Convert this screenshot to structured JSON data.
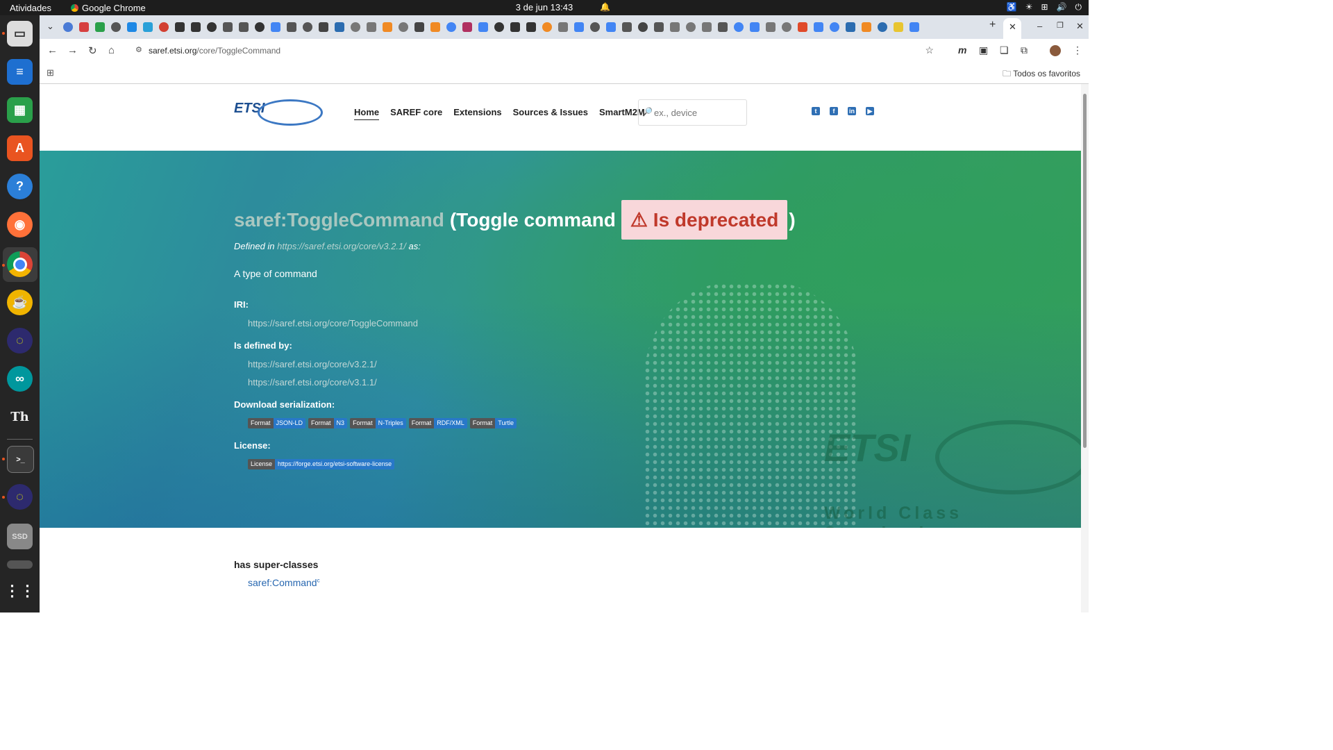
{
  "os": {
    "activities": "Atividades",
    "app_name": "Google Chrome",
    "clock": "3 de jun  13:43"
  },
  "browser": {
    "url_host": "saref.etsi.org",
    "url_path": "/core/ToggleCommand",
    "bookmarks_folder": "Todos os favoritos"
  },
  "site": {
    "nav": {
      "home": "Home",
      "saref_core": "SAREF core",
      "extensions": "Extensions",
      "sources_issues": "Sources & Issues",
      "smartm2m": "SmartM2M"
    },
    "search_placeholder": "ex., device",
    "logo_text": "ETSI"
  },
  "entity": {
    "class_name": "saref:ToggleCommand",
    "label": "(Toggle command",
    "closing": ")",
    "deprecated": "⚠ Is deprecated",
    "defined_in_prefix": "Defined in",
    "defined_in_link": "https://saref.etsi.org/core/v3.2.1/",
    "defined_in_suffix": "as:",
    "comment": "A type of command",
    "iri_label": "IRI:",
    "iri": "https://saref.etsi.org/core/ToggleCommand",
    "defined_by_label": "Is defined by:",
    "defined_by": [
      "https://saref.etsi.org/core/v3.2.1/",
      "https://saref.etsi.org/core/v3.1.1/"
    ],
    "download_label": "Download serialization:",
    "formats": [
      {
        "key": "Format",
        "value": "JSON-LD"
      },
      {
        "key": "Format",
        "value": "N3"
      },
      {
        "key": "Format",
        "value": "N-Triples"
      },
      {
        "key": "Format",
        "value": "RDF/XML"
      },
      {
        "key": "Format",
        "value": "Turtle"
      }
    ],
    "license_label": "License:",
    "license_key": "License",
    "license_value": "https://forge.etsi.org/etsi-software-license",
    "superclasses_label": "has super-classes",
    "superclass": "saref:Command",
    "superclass_marker": "c"
  },
  "hero_watermark": {
    "logo": "ETSI",
    "tagline": "World Class Standards"
  },
  "colors": {
    "link_blue": "#2767b0",
    "deprecated_bg": "#f8d7da",
    "deprecated_text": "#c0392b",
    "badge_value": "#2878c8"
  }
}
